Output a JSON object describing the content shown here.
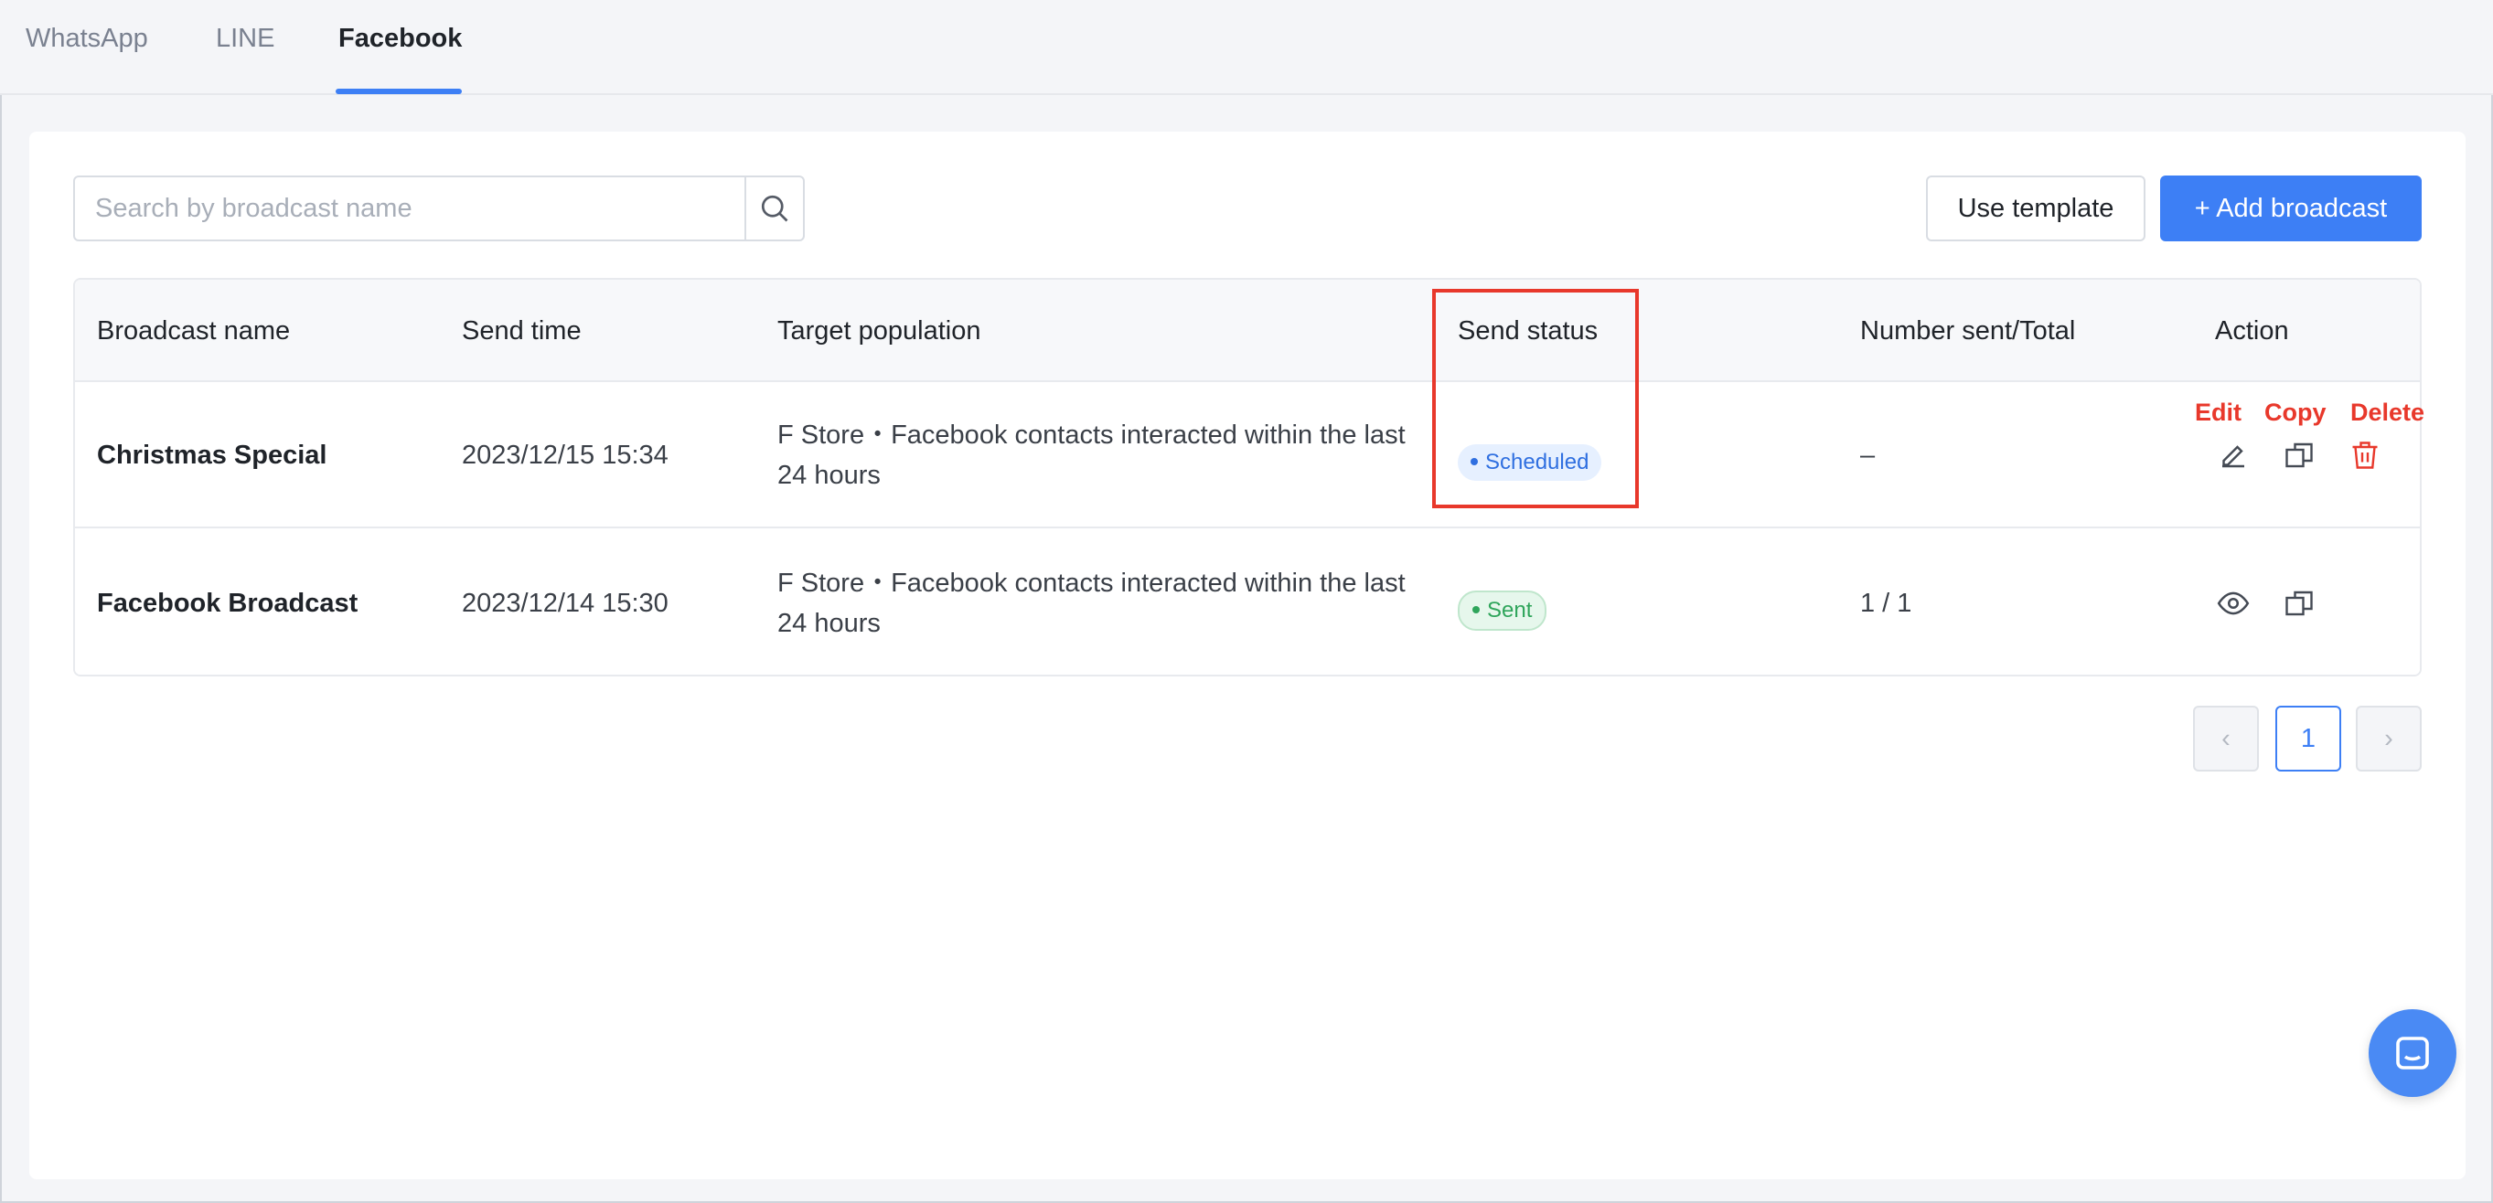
{
  "tabs": [
    {
      "label": "WhatsApp",
      "active": false
    },
    {
      "label": "LINE",
      "active": false
    },
    {
      "label": "Facebook",
      "active": true
    }
  ],
  "toolbar": {
    "search_placeholder": "Search by broadcast name",
    "use_template_label": "Use template",
    "add_broadcast_label": "+ Add broadcast"
  },
  "table": {
    "headers": [
      "Broadcast name",
      "Send time",
      "Target population",
      "Send status",
      "Number sent/Total",
      "Action"
    ],
    "rows": [
      {
        "name": "Christmas Special",
        "send_time": "2023/12/15 15:34",
        "target": "F Store・Facebook contacts interacted within the last 24 hours",
        "status": "Scheduled",
        "count": "–",
        "actions": [
          "edit-icon",
          "copy-icon",
          "delete-icon"
        ]
      },
      {
        "name": "Facebook Broadcast",
        "send_time": "2023/12/14 15:30",
        "target": "F Store・Facebook contacts interacted within the last 24 hours",
        "status": "Sent",
        "count": "1 / 1",
        "actions": [
          "view-icon",
          "copy-icon"
        ]
      }
    ]
  },
  "annotations": {
    "edit": "Edit",
    "copy": "Copy",
    "delete": "Delete"
  },
  "pagination": {
    "prev": "‹",
    "current": "1",
    "next": "›"
  },
  "colors": {
    "accent": "#3d7ff5",
    "annotation_red": "#e8382b",
    "scheduled_text": "#2f6fe0",
    "sent_text": "#2fa55b"
  },
  "chat": {
    "icon": "chat-icon"
  }
}
